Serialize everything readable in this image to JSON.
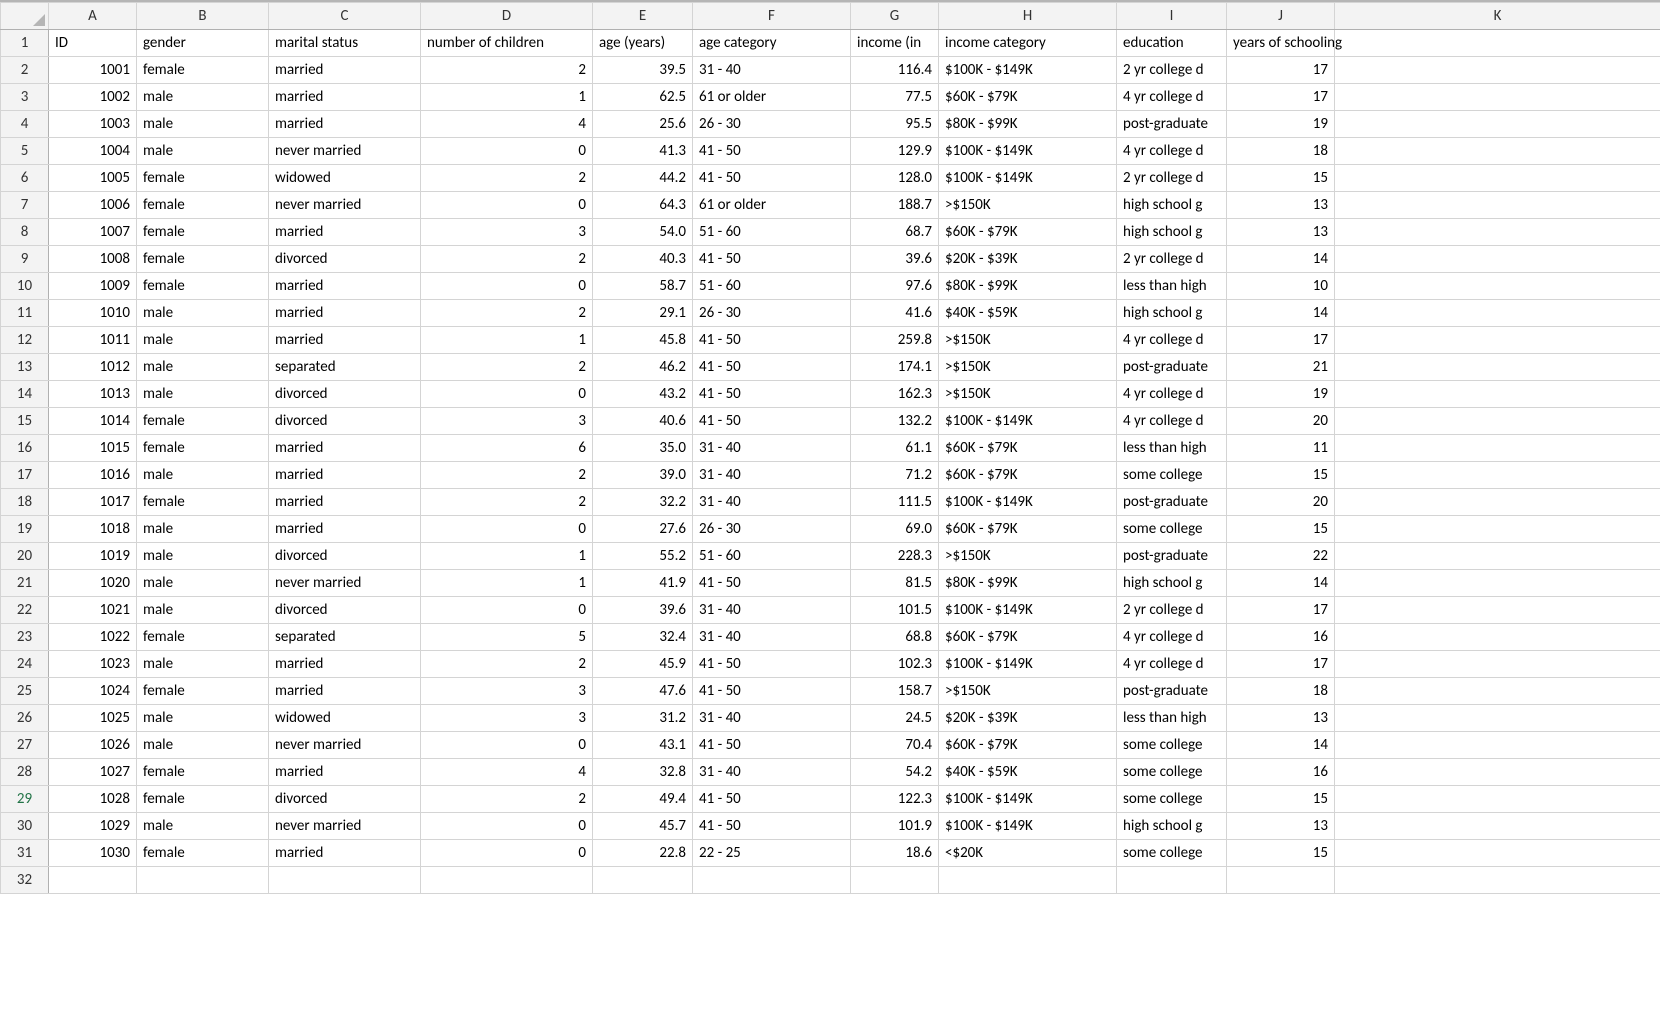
{
  "columns": [
    "A",
    "B",
    "C",
    "D",
    "E",
    "F",
    "G",
    "H",
    "I",
    "J",
    "K"
  ],
  "header_row": {
    "A": "ID",
    "B": "gender",
    "C": "marital status",
    "D": "number of children",
    "E": "age (years)",
    "F": "age category",
    "G": "income (in",
    "H": "income category",
    "I": "education",
    "J": "years of schooling",
    "K": ""
  },
  "active_row": 29,
  "rows": [
    {
      "n": 2,
      "A": "1001",
      "B": "female",
      "C": "married",
      "D": "2",
      "E": "39.5",
      "F": "31 - 40",
      "G": "116.4",
      "H": "$100K - $149K",
      "I": "2 yr college d",
      "J": "17"
    },
    {
      "n": 3,
      "A": "1002",
      "B": "male",
      "C": "married",
      "D": "1",
      "E": "62.5",
      "F": "61 or older",
      "G": "77.5",
      "H": "$60K - $79K",
      "I": "4 yr college d",
      "J": "17"
    },
    {
      "n": 4,
      "A": "1003",
      "B": "male",
      "C": "married",
      "D": "4",
      "E": "25.6",
      "F": "26 - 30",
      "G": "95.5",
      "H": "$80K - $99K",
      "I": "post-graduate",
      "J": "19"
    },
    {
      "n": 5,
      "A": "1004",
      "B": "male",
      "C": "never married",
      "D": "0",
      "E": "41.3",
      "F": "41 - 50",
      "G": "129.9",
      "H": "$100K - $149K",
      "I": "4 yr college d",
      "J": "18"
    },
    {
      "n": 6,
      "A": "1005",
      "B": "female",
      "C": "widowed",
      "D": "2",
      "E": "44.2",
      "F": "41 - 50",
      "G": "128.0",
      "H": "$100K - $149K",
      "I": "2 yr college d",
      "J": "15"
    },
    {
      "n": 7,
      "A": "1006",
      "B": "female",
      "C": "never married",
      "D": "0",
      "E": "64.3",
      "F": "61 or older",
      "G": "188.7",
      "H": ">$150K",
      "I": "high school g",
      "J": "13"
    },
    {
      "n": 8,
      "A": "1007",
      "B": "female",
      "C": "married",
      "D": "3",
      "E": "54.0",
      "F": "51 - 60",
      "G": "68.7",
      "H": "$60K - $79K",
      "I": "high school g",
      "J": "13"
    },
    {
      "n": 9,
      "A": "1008",
      "B": "female",
      "C": "divorced",
      "D": "2",
      "E": "40.3",
      "F": "41 - 50",
      "G": "39.6",
      "H": "$20K - $39K",
      "I": "2 yr college d",
      "J": "14"
    },
    {
      "n": 10,
      "A": "1009",
      "B": "female",
      "C": "married",
      "D": "0",
      "E": "58.7",
      "F": "51 - 60",
      "G": "97.6",
      "H": "$80K - $99K",
      "I": "less than high",
      "J": "10"
    },
    {
      "n": 11,
      "A": "1010",
      "B": "male",
      "C": "married",
      "D": "2",
      "E": "29.1",
      "F": "26 - 30",
      "G": "41.6",
      "H": "$40K - $59K",
      "I": "high school g",
      "J": "14"
    },
    {
      "n": 12,
      "A": "1011",
      "B": "male",
      "C": "married",
      "D": "1",
      "E": "45.8",
      "F": "41 - 50",
      "G": "259.8",
      "H": ">$150K",
      "I": "4 yr college d",
      "J": "17"
    },
    {
      "n": 13,
      "A": "1012",
      "B": "male",
      "C": "separated",
      "D": "2",
      "E": "46.2",
      "F": "41 - 50",
      "G": "174.1",
      "H": ">$150K",
      "I": "post-graduate",
      "J": "21"
    },
    {
      "n": 14,
      "A": "1013",
      "B": "male",
      "C": "divorced",
      "D": "0",
      "E": "43.2",
      "F": "41 - 50",
      "G": "162.3",
      "H": ">$150K",
      "I": "4 yr college d",
      "J": "19"
    },
    {
      "n": 15,
      "A": "1014",
      "B": "female",
      "C": "divorced",
      "D": "3",
      "E": "40.6",
      "F": "41 - 50",
      "G": "132.2",
      "H": "$100K - $149K",
      "I": "4 yr college d",
      "J": "20"
    },
    {
      "n": 16,
      "A": "1015",
      "B": "female",
      "C": "married",
      "D": "6",
      "E": "35.0",
      "F": "31 - 40",
      "G": "61.1",
      "H": "$60K - $79K",
      "I": "less than high",
      "J": "11"
    },
    {
      "n": 17,
      "A": "1016",
      "B": "male",
      "C": "married",
      "D": "2",
      "E": "39.0",
      "F": "31 - 40",
      "G": "71.2",
      "H": "$60K - $79K",
      "I": "some college",
      "J": "15"
    },
    {
      "n": 18,
      "A": "1017",
      "B": "female",
      "C": "married",
      "D": "2",
      "E": "32.2",
      "F": "31 - 40",
      "G": "111.5",
      "H": "$100K - $149K",
      "I": "post-graduate",
      "J": "20"
    },
    {
      "n": 19,
      "A": "1018",
      "B": "male",
      "C": "married",
      "D": "0",
      "E": "27.6",
      "F": "26 - 30",
      "G": "69.0",
      "H": "$60K - $79K",
      "I": "some college",
      "J": "15"
    },
    {
      "n": 20,
      "A": "1019",
      "B": "male",
      "C": "divorced",
      "D": "1",
      "E": "55.2",
      "F": "51 - 60",
      "G": "228.3",
      "H": ">$150K",
      "I": "post-graduate",
      "J": "22"
    },
    {
      "n": 21,
      "A": "1020",
      "B": "male",
      "C": "never married",
      "D": "1",
      "E": "41.9",
      "F": "41 - 50",
      "G": "81.5",
      "H": "$80K - $99K",
      "I": "high school g",
      "J": "14"
    },
    {
      "n": 22,
      "A": "1021",
      "B": "male",
      "C": "divorced",
      "D": "0",
      "E": "39.6",
      "F": "31 - 40",
      "G": "101.5",
      "H": "$100K - $149K",
      "I": "2 yr college d",
      "J": "17"
    },
    {
      "n": 23,
      "A": "1022",
      "B": "female",
      "C": "separated",
      "D": "5",
      "E": "32.4",
      "F": "31 - 40",
      "G": "68.8",
      "H": "$60K - $79K",
      "I": "4 yr college d",
      "J": "16"
    },
    {
      "n": 24,
      "A": "1023",
      "B": "male",
      "C": "married",
      "D": "2",
      "E": "45.9",
      "F": "41 - 50",
      "G": "102.3",
      "H": "$100K - $149K",
      "I": "4 yr college d",
      "J": "17"
    },
    {
      "n": 25,
      "A": "1024",
      "B": "female",
      "C": "married",
      "D": "3",
      "E": "47.6",
      "F": "41 - 50",
      "G": "158.7",
      "H": ">$150K",
      "I": "post-graduate",
      "J": "18"
    },
    {
      "n": 26,
      "A": "1025",
      "B": "male",
      "C": "widowed",
      "D": "3",
      "E": "31.2",
      "F": "31 - 40",
      "G": "24.5",
      "H": "$20K - $39K",
      "I": "less than high",
      "J": "13"
    },
    {
      "n": 27,
      "A": "1026",
      "B": "male",
      "C": "never married",
      "D": "0",
      "E": "43.1",
      "F": "41 - 50",
      "G": "70.4",
      "H": "$60K - $79K",
      "I": "some college",
      "J": "14"
    },
    {
      "n": 28,
      "A": "1027",
      "B": "female",
      "C": "married",
      "D": "4",
      "E": "32.8",
      "F": "31 - 40",
      "G": "54.2",
      "H": "$40K - $59K",
      "I": "some college",
      "J": "16"
    },
    {
      "n": 29,
      "A": "1028",
      "B": "female",
      "C": "divorced",
      "D": "2",
      "E": "49.4",
      "F": "41 - 50",
      "G": "122.3",
      "H": "$100K - $149K",
      "I": "some college",
      "J": "15"
    },
    {
      "n": 30,
      "A": "1029",
      "B": "male",
      "C": "never married",
      "D": "0",
      "E": "45.7",
      "F": "41 - 50",
      "G": "101.9",
      "H": "$100K - $149K",
      "I": "high school g",
      "J": "13"
    },
    {
      "n": 31,
      "A": "1030",
      "B": "female",
      "C": "married",
      "D": "0",
      "E": "22.8",
      "F": "22 - 25",
      "G": "18.6",
      "H": "<$20K",
      "I": "some college",
      "J": "15"
    },
    {
      "n": 32,
      "A": "",
      "B": "",
      "C": "",
      "D": "",
      "E": "",
      "F": "",
      "G": "",
      "H": "",
      "I": "",
      "J": ""
    }
  ],
  "numeric_cols": [
    "A",
    "D",
    "E",
    "G",
    "J"
  ],
  "text_cols": [
    "B",
    "C",
    "F",
    "H",
    "I"
  ]
}
